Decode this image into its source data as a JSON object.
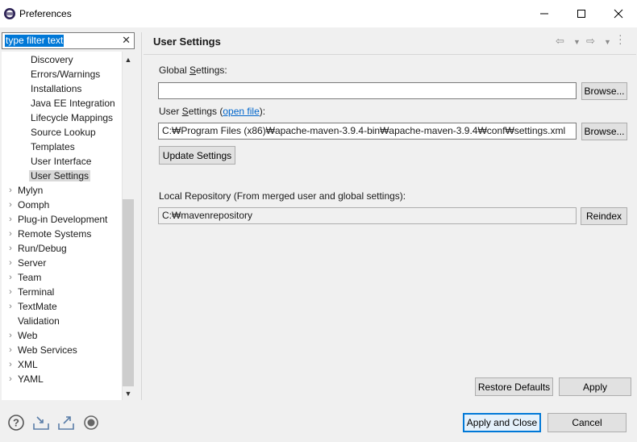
{
  "window": {
    "title": "Preferences",
    "minimize_icon": "minimize-icon",
    "maximize_icon": "maximize-icon",
    "close_icon": "close-icon"
  },
  "filter": {
    "value": "type filter text",
    "clear_icon": "clear-icon"
  },
  "tree": {
    "items": [
      {
        "label": "Discovery",
        "level": 2,
        "expandable": false,
        "selected": false
      },
      {
        "label": "Errors/Warnings",
        "level": 2,
        "expandable": false,
        "selected": false
      },
      {
        "label": "Installations",
        "level": 2,
        "expandable": false,
        "selected": false
      },
      {
        "label": "Java EE Integration",
        "level": 2,
        "expandable": false,
        "selected": false
      },
      {
        "label": "Lifecycle Mappings",
        "level": 2,
        "expandable": false,
        "selected": false
      },
      {
        "label": "Source Lookup",
        "level": 2,
        "expandable": false,
        "selected": false
      },
      {
        "label": "Templates",
        "level": 2,
        "expandable": false,
        "selected": false
      },
      {
        "label": "User Interface",
        "level": 2,
        "expandable": false,
        "selected": false
      },
      {
        "label": "User Settings",
        "level": 2,
        "expandable": false,
        "selected": true
      },
      {
        "label": "Mylyn",
        "level": 1,
        "expandable": true,
        "selected": false
      },
      {
        "label": "Oomph",
        "level": 1,
        "expandable": true,
        "selected": false
      },
      {
        "label": "Plug-in Development",
        "level": 1,
        "expandable": true,
        "selected": false
      },
      {
        "label": "Remote Systems",
        "level": 1,
        "expandable": true,
        "selected": false
      },
      {
        "label": "Run/Debug",
        "level": 1,
        "expandable": true,
        "selected": false
      },
      {
        "label": "Server",
        "level": 1,
        "expandable": true,
        "selected": false
      },
      {
        "label": "Team",
        "level": 1,
        "expandable": true,
        "selected": false
      },
      {
        "label": "Terminal",
        "level": 1,
        "expandable": true,
        "selected": false
      },
      {
        "label": "TextMate",
        "level": 1,
        "expandable": true,
        "selected": false
      },
      {
        "label": "Validation",
        "level": 1,
        "expandable": false,
        "selected": false
      },
      {
        "label": "Web",
        "level": 1,
        "expandable": true,
        "selected": false
      },
      {
        "label": "Web Services",
        "level": 1,
        "expandable": true,
        "selected": false
      },
      {
        "label": "XML",
        "level": 1,
        "expandable": true,
        "selected": false
      },
      {
        "label": "YAML",
        "level": 1,
        "expandable": true,
        "selected": false
      }
    ]
  },
  "page": {
    "title": "User Settings",
    "global_settings_label_pre": "Global ",
    "global_settings_label_s": "S",
    "global_settings_label_post": "ettings:",
    "global_settings_value": "",
    "user_settings_label_pre": "User ",
    "user_settings_label_s": "S",
    "user_settings_label_post": "ettings (",
    "open_file_link": "open file",
    "user_settings_label_end": "):",
    "user_settings_value": "C:₩Program Files (x86)₩apache-maven-3.9.4-bin₩apache-maven-3.9.4₩conf₩settings.xml",
    "browse_label": "Browse...",
    "update_settings_label": "Update Settings",
    "local_repo_label": "Local Repository (From merged user and global settings):",
    "local_repo_value": "C:₩mavenrepository",
    "reindex_label": "Reindex",
    "restore_defaults_label": "Restore Defaults",
    "apply_label": "Apply"
  },
  "footer": {
    "apply_close_label": "Apply and Close",
    "cancel_label": "Cancel",
    "icons": [
      "help-icon",
      "import-icon",
      "export-icon",
      "record-icon"
    ]
  }
}
